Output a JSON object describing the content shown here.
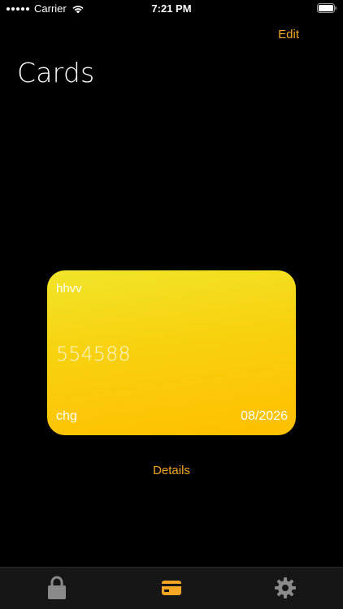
{
  "status_bar": {
    "carrier": "Carrier",
    "time": "7:21 PM"
  },
  "nav": {
    "edit_label": "Edit",
    "title": "Cards"
  },
  "card": {
    "name": "hhvv",
    "number": "554588",
    "holder": "chg",
    "expiry": "08/2026"
  },
  "details_label": "Details",
  "tab_bar": {
    "items": [
      {
        "icon": "lock-icon",
        "selected": false
      },
      {
        "icon": "credit-card-icon",
        "selected": true
      },
      {
        "icon": "gear-icon",
        "selected": false
      }
    ]
  },
  "colors": {
    "accent": "#f5a623",
    "card_gradient_top": "#f1e52a",
    "card_gradient_bottom": "#ffbf00",
    "tab_inactive": "#8a8a8a",
    "background": "#000000"
  }
}
